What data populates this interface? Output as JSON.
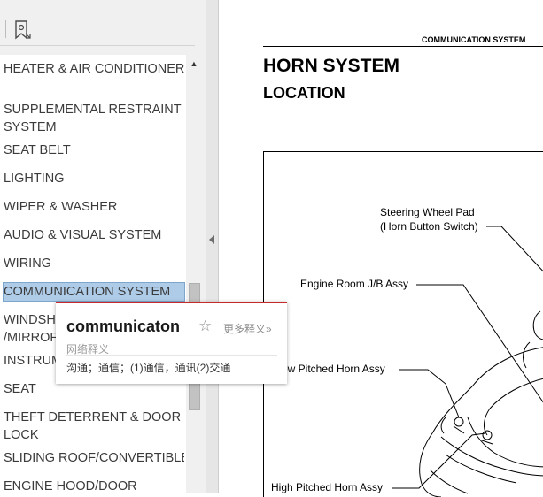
{
  "bookmarks": {
    "items": [
      {
        "label": "HEATER & AIR CONDITIONER"
      },
      {
        "label": "SUPPLEMENTAL RESTRAINT"
      },
      {
        "label": "SYSTEM"
      },
      {
        "label": "SEAT BELT"
      },
      {
        "label": "LIGHTING"
      },
      {
        "label": "WIPER & WASHER"
      },
      {
        "label": "AUDIO & VISUAL SYSTEM"
      },
      {
        "label": "WIRING"
      },
      {
        "label": "COMMUNICATION SYSTEM",
        "selected": true
      },
      {
        "label": "WINDSH"
      },
      {
        "label": "/MIRROF"
      },
      {
        "label": "INSTRUM"
      },
      {
        "label": "SEAT"
      },
      {
        "label": "THEFT DETERRENT & DOOR"
      },
      {
        "label": "LOCK"
      },
      {
        "label": "SLIDING ROOF/CONVERTIBLE"
      },
      {
        "label": "ENGINE HOOD/DOOR"
      }
    ]
  },
  "document": {
    "header": "COMMUNICATION SYSTEM",
    "title": "HORN SYSTEM",
    "subtitle": "LOCATION",
    "callouts": {
      "steering_line1": "Steering Wheel Pad",
      "steering_line2": "(Horn Button Switch)",
      "engine_room": "Engine Room J/B Assy",
      "low_horn": "ow Pitched Horn Assy",
      "high_horn": "High Pitched Horn Assy"
    }
  },
  "dictionary": {
    "word": "communicaton",
    "star": "☆",
    "more": "更多释义»",
    "section": "网络释义",
    "meaning": "沟通；通信；(1)通信，通讯(2)交通"
  },
  "colors": {
    "selection": "#aecbe8",
    "popup_accent": "#c62b2b"
  }
}
